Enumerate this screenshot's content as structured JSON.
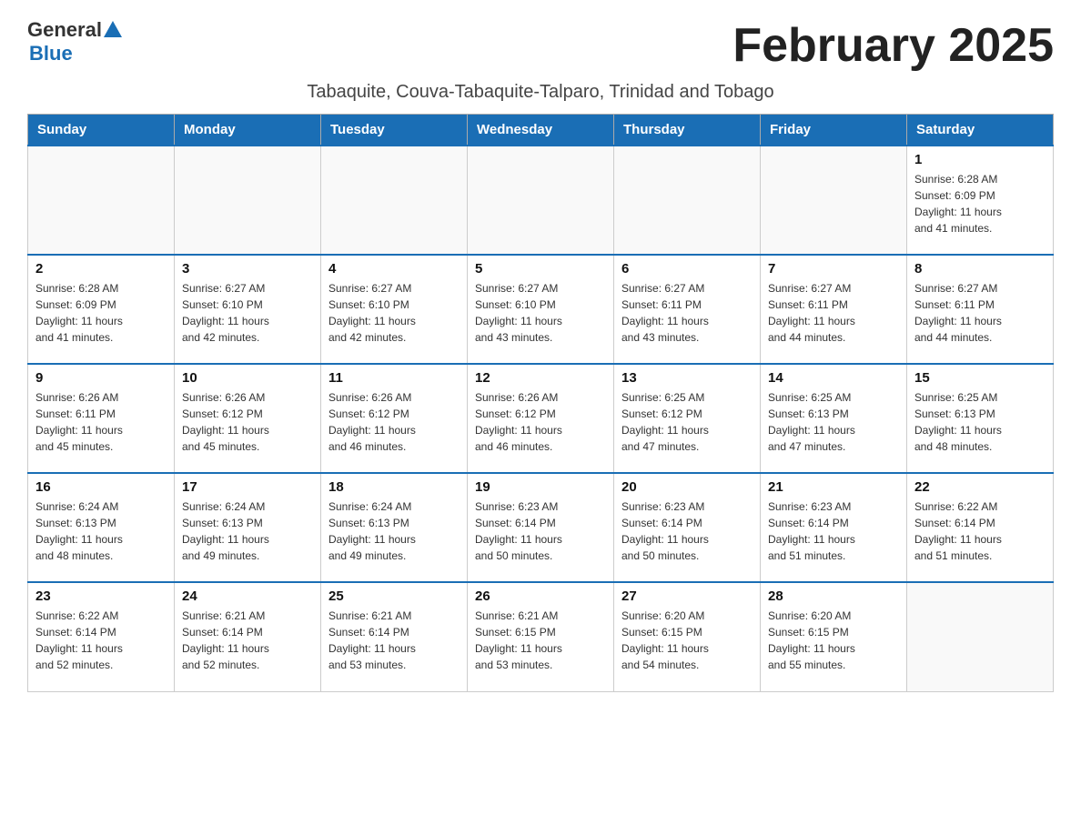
{
  "header": {
    "logo_general": "General",
    "logo_blue": "Blue",
    "month_title": "February 2025",
    "subtitle": "Tabaquite, Couva-Tabaquite-Talparo, Trinidad and Tobago"
  },
  "days_of_week": [
    "Sunday",
    "Monday",
    "Tuesday",
    "Wednesday",
    "Thursday",
    "Friday",
    "Saturday"
  ],
  "weeks": [
    {
      "days": [
        {
          "num": "",
          "info": ""
        },
        {
          "num": "",
          "info": ""
        },
        {
          "num": "",
          "info": ""
        },
        {
          "num": "",
          "info": ""
        },
        {
          "num": "",
          "info": ""
        },
        {
          "num": "",
          "info": ""
        },
        {
          "num": "1",
          "info": "Sunrise: 6:28 AM\nSunset: 6:09 PM\nDaylight: 11 hours\nand 41 minutes."
        }
      ]
    },
    {
      "days": [
        {
          "num": "2",
          "info": "Sunrise: 6:28 AM\nSunset: 6:09 PM\nDaylight: 11 hours\nand 41 minutes."
        },
        {
          "num": "3",
          "info": "Sunrise: 6:27 AM\nSunset: 6:10 PM\nDaylight: 11 hours\nand 42 minutes."
        },
        {
          "num": "4",
          "info": "Sunrise: 6:27 AM\nSunset: 6:10 PM\nDaylight: 11 hours\nand 42 minutes."
        },
        {
          "num": "5",
          "info": "Sunrise: 6:27 AM\nSunset: 6:10 PM\nDaylight: 11 hours\nand 43 minutes."
        },
        {
          "num": "6",
          "info": "Sunrise: 6:27 AM\nSunset: 6:11 PM\nDaylight: 11 hours\nand 43 minutes."
        },
        {
          "num": "7",
          "info": "Sunrise: 6:27 AM\nSunset: 6:11 PM\nDaylight: 11 hours\nand 44 minutes."
        },
        {
          "num": "8",
          "info": "Sunrise: 6:27 AM\nSunset: 6:11 PM\nDaylight: 11 hours\nand 44 minutes."
        }
      ]
    },
    {
      "days": [
        {
          "num": "9",
          "info": "Sunrise: 6:26 AM\nSunset: 6:11 PM\nDaylight: 11 hours\nand 45 minutes."
        },
        {
          "num": "10",
          "info": "Sunrise: 6:26 AM\nSunset: 6:12 PM\nDaylight: 11 hours\nand 45 minutes."
        },
        {
          "num": "11",
          "info": "Sunrise: 6:26 AM\nSunset: 6:12 PM\nDaylight: 11 hours\nand 46 minutes."
        },
        {
          "num": "12",
          "info": "Sunrise: 6:26 AM\nSunset: 6:12 PM\nDaylight: 11 hours\nand 46 minutes."
        },
        {
          "num": "13",
          "info": "Sunrise: 6:25 AM\nSunset: 6:12 PM\nDaylight: 11 hours\nand 47 minutes."
        },
        {
          "num": "14",
          "info": "Sunrise: 6:25 AM\nSunset: 6:13 PM\nDaylight: 11 hours\nand 47 minutes."
        },
        {
          "num": "15",
          "info": "Sunrise: 6:25 AM\nSunset: 6:13 PM\nDaylight: 11 hours\nand 48 minutes."
        }
      ]
    },
    {
      "days": [
        {
          "num": "16",
          "info": "Sunrise: 6:24 AM\nSunset: 6:13 PM\nDaylight: 11 hours\nand 48 minutes."
        },
        {
          "num": "17",
          "info": "Sunrise: 6:24 AM\nSunset: 6:13 PM\nDaylight: 11 hours\nand 49 minutes."
        },
        {
          "num": "18",
          "info": "Sunrise: 6:24 AM\nSunset: 6:13 PM\nDaylight: 11 hours\nand 49 minutes."
        },
        {
          "num": "19",
          "info": "Sunrise: 6:23 AM\nSunset: 6:14 PM\nDaylight: 11 hours\nand 50 minutes."
        },
        {
          "num": "20",
          "info": "Sunrise: 6:23 AM\nSunset: 6:14 PM\nDaylight: 11 hours\nand 50 minutes."
        },
        {
          "num": "21",
          "info": "Sunrise: 6:23 AM\nSunset: 6:14 PM\nDaylight: 11 hours\nand 51 minutes."
        },
        {
          "num": "22",
          "info": "Sunrise: 6:22 AM\nSunset: 6:14 PM\nDaylight: 11 hours\nand 51 minutes."
        }
      ]
    },
    {
      "days": [
        {
          "num": "23",
          "info": "Sunrise: 6:22 AM\nSunset: 6:14 PM\nDaylight: 11 hours\nand 52 minutes."
        },
        {
          "num": "24",
          "info": "Sunrise: 6:21 AM\nSunset: 6:14 PM\nDaylight: 11 hours\nand 52 minutes."
        },
        {
          "num": "25",
          "info": "Sunrise: 6:21 AM\nSunset: 6:14 PM\nDaylight: 11 hours\nand 53 minutes."
        },
        {
          "num": "26",
          "info": "Sunrise: 6:21 AM\nSunset: 6:15 PM\nDaylight: 11 hours\nand 53 minutes."
        },
        {
          "num": "27",
          "info": "Sunrise: 6:20 AM\nSunset: 6:15 PM\nDaylight: 11 hours\nand 54 minutes."
        },
        {
          "num": "28",
          "info": "Sunrise: 6:20 AM\nSunset: 6:15 PM\nDaylight: 11 hours\nand 55 minutes."
        },
        {
          "num": "",
          "info": ""
        }
      ]
    }
  ]
}
